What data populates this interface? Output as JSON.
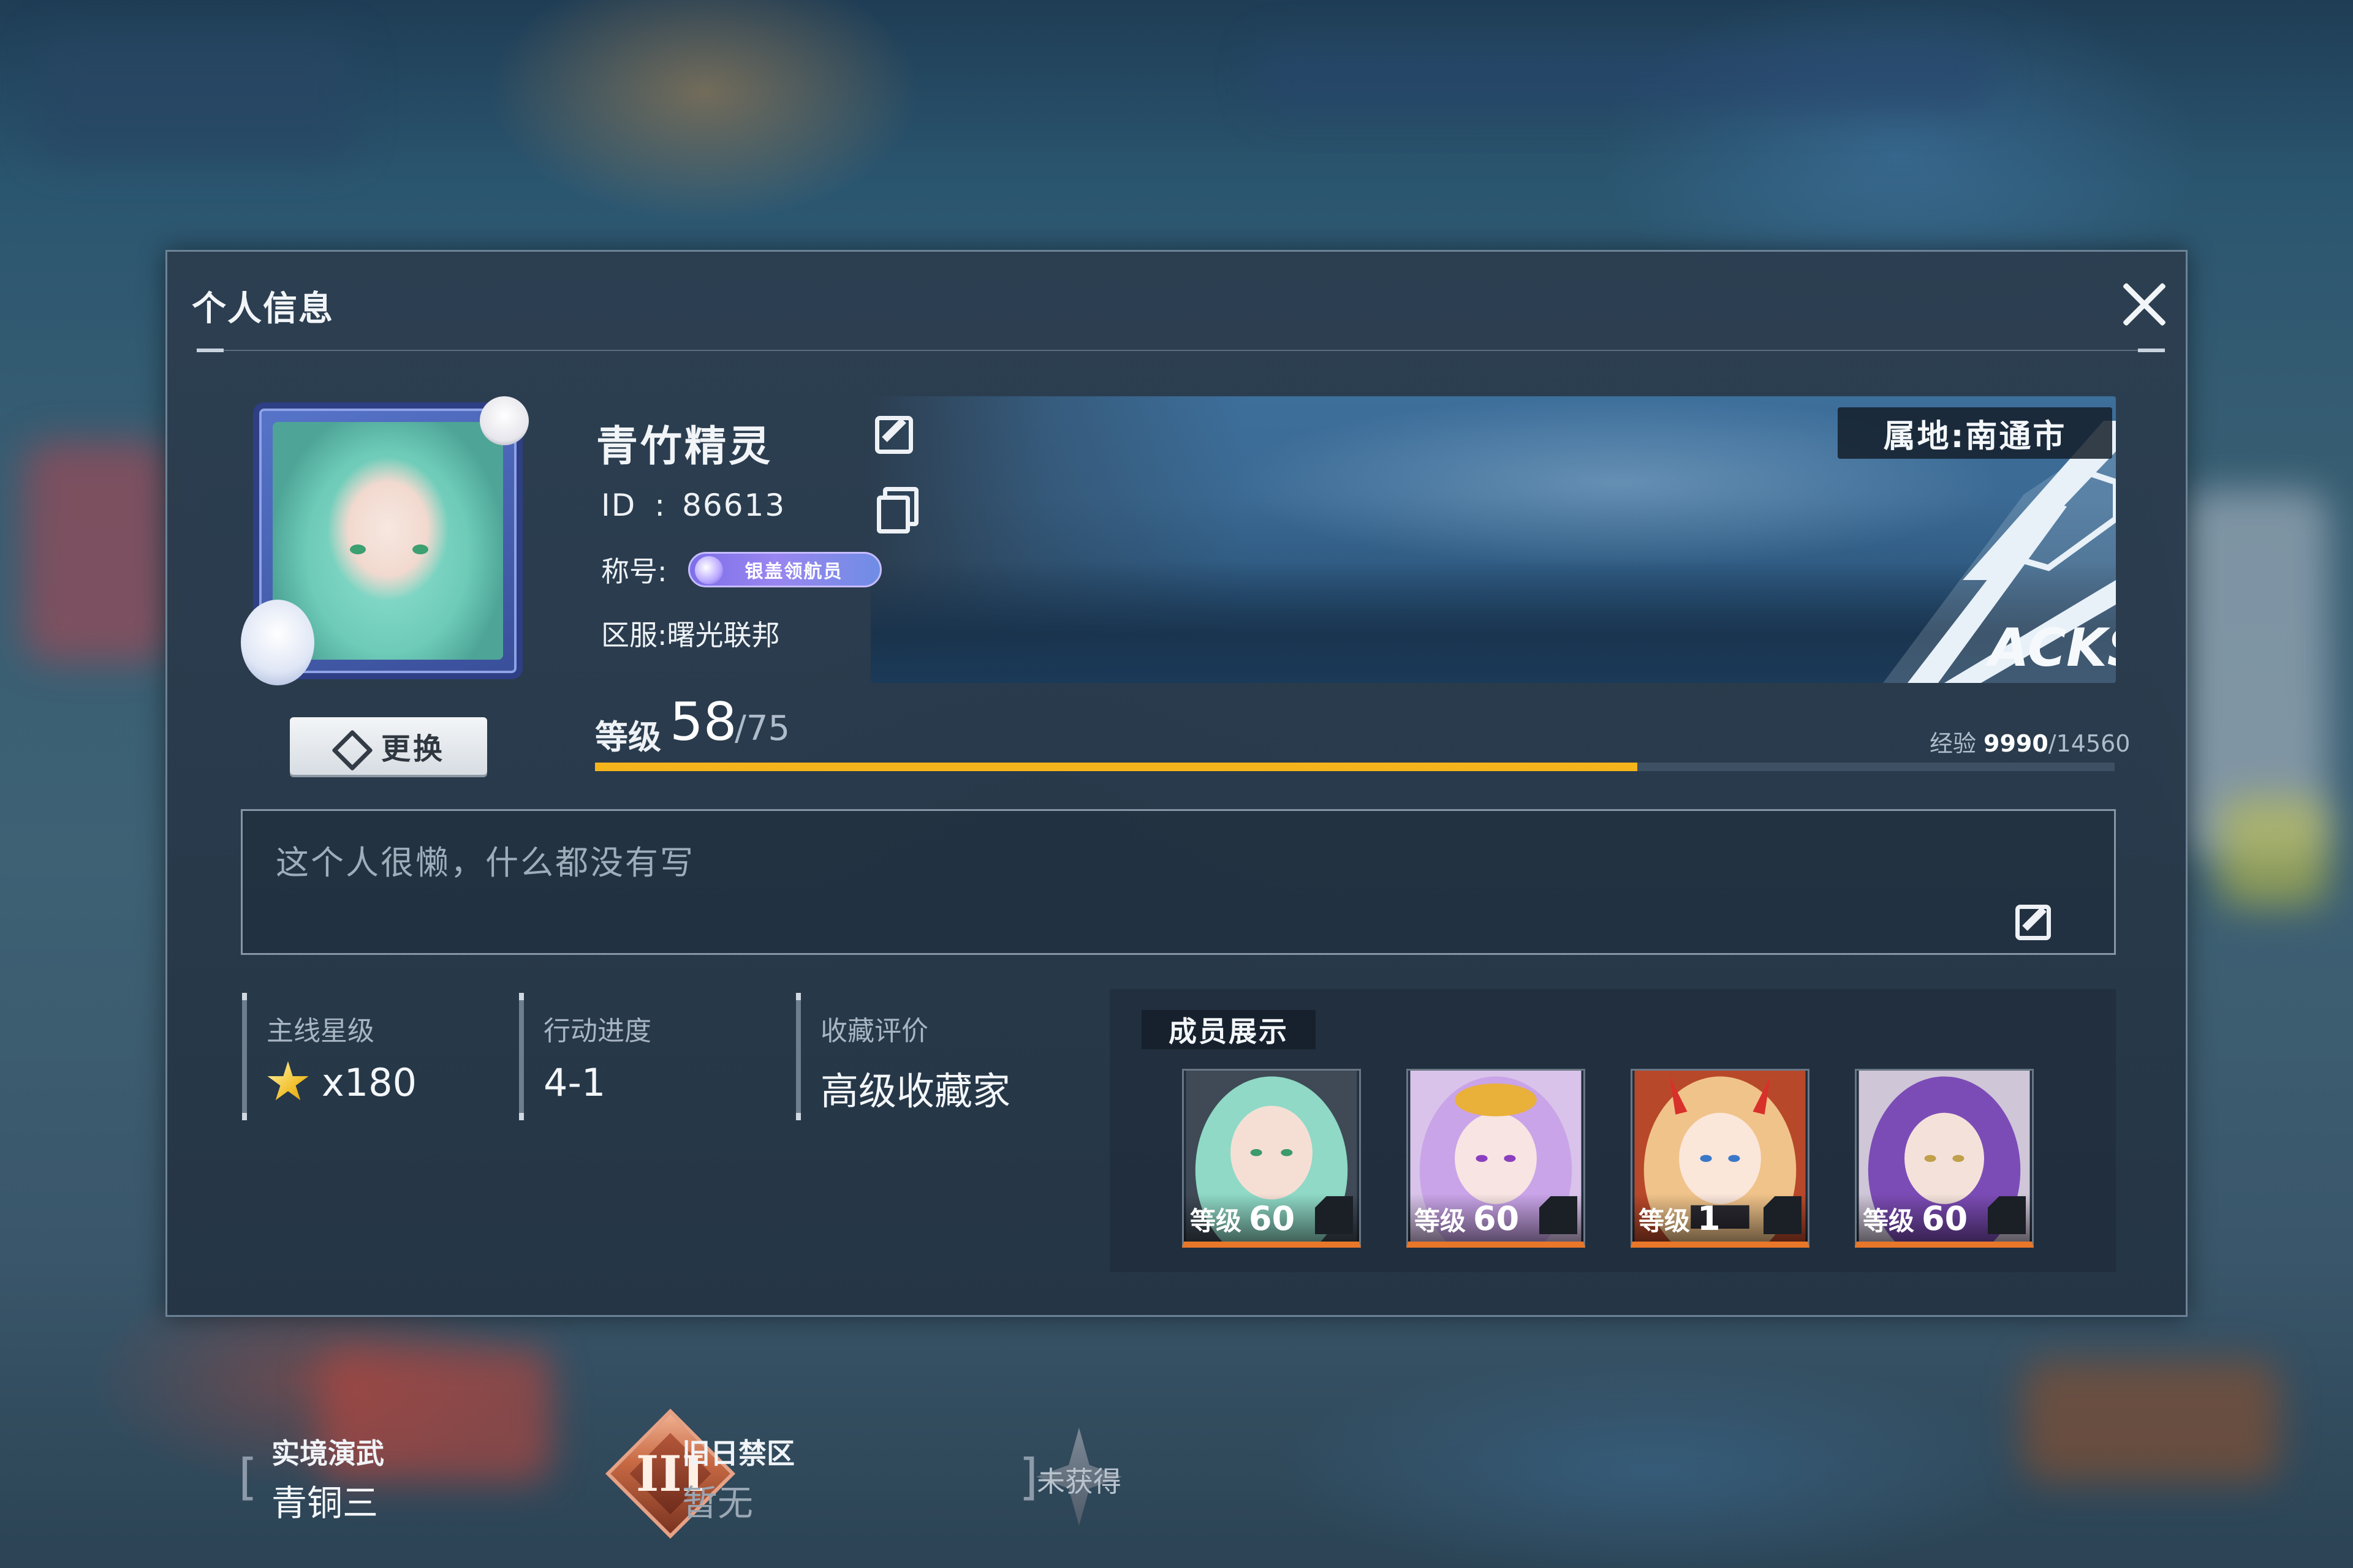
{
  "window": {
    "title": "个人信息",
    "close_icon": "close-icon"
  },
  "profile": {
    "name": "青竹精灵",
    "id_label": "ID",
    "id_colon": ":",
    "id_value": "86613",
    "title_label": "称号:",
    "title_badge": "银盖领航员",
    "server_label": "区服:",
    "server_value": "曙光联邦",
    "change_button": "更换",
    "region_label": "属地:",
    "region_value": "南通市",
    "banner_logo_text": "ACKS QUAD"
  },
  "level": {
    "label": "等级",
    "value": "58",
    "max": "/75",
    "exp_label": "经验",
    "exp_current": "9990",
    "exp_max": "/14560",
    "exp_fraction": 0.686
  },
  "signature": {
    "text": "这个人很懒，什么都没有写"
  },
  "stats": [
    {
      "label": "主线星级",
      "value": "x180"
    },
    {
      "label": "行动进度",
      "value": "4-1"
    },
    {
      "label": "收藏评价",
      "value": "高级收藏家"
    }
  ],
  "ranks": {
    "arena_label": "实境演武",
    "arena_value": "青铜三",
    "arena_badge": "III",
    "zone_label": "旧日禁区",
    "zone_value": "暂无",
    "zone_badge": "未获得",
    "bracket_open": "[",
    "bracket_close": "]"
  },
  "members": {
    "title": "成员展示",
    "level_label": "等级",
    "items": [
      {
        "level": "60",
        "hair": "#8fd9c6",
        "bg": "#3f4a56"
      },
      {
        "level": "60",
        "hair": "#c9a4e8",
        "bg": "#d9c3ea"
      },
      {
        "level": "1",
        "hair": "#f0c38a",
        "bg": "#b8482a"
      },
      {
        "level": "60",
        "hair": "#7c4cb6",
        "bg": "#cfc6d8"
      }
    ]
  },
  "colors": {
    "accent": "#f4b51c",
    "card_border": "#e8772a"
  }
}
